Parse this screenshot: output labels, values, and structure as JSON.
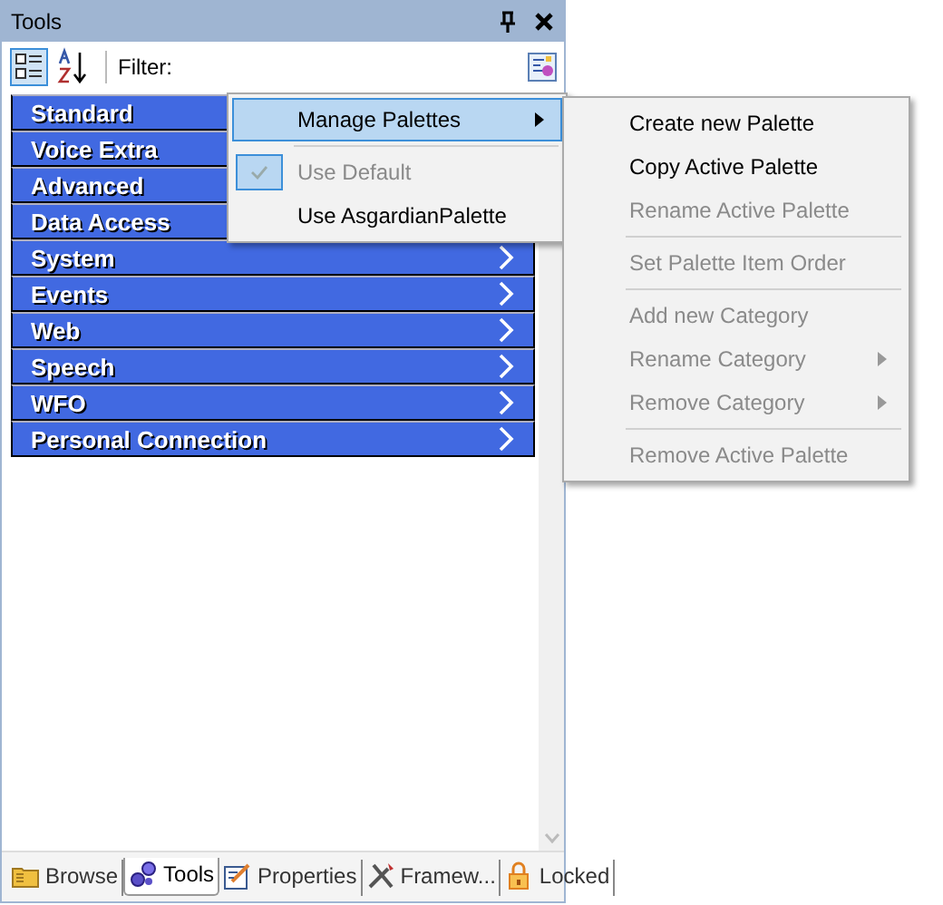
{
  "panel": {
    "title": "Tools",
    "filter_label": "Filter:"
  },
  "categories": [
    {
      "label": "Standard",
      "chevron": false
    },
    {
      "label": "Voice Extra",
      "chevron": false
    },
    {
      "label": "Advanced",
      "chevron": false
    },
    {
      "label": "Data Access",
      "chevron": false
    },
    {
      "label": "System",
      "chevron": true
    },
    {
      "label": "Events",
      "chevron": true
    },
    {
      "label": "Web",
      "chevron": true
    },
    {
      "label": "Speech",
      "chevron": true
    },
    {
      "label": "WFO",
      "chevron": true
    },
    {
      "label": "Personal Connection",
      "chevron": true
    }
  ],
  "context_menu": [
    {
      "kind": "item",
      "label": "Manage Palettes",
      "selected": true,
      "submenu": true,
      "disabled": false,
      "checked": false
    },
    {
      "kind": "separator"
    },
    {
      "kind": "item",
      "label": "Use Default",
      "selected": false,
      "submenu": false,
      "disabled": true,
      "checked": true
    },
    {
      "kind": "item",
      "label": "Use AsgardianPalette",
      "selected": false,
      "submenu": false,
      "disabled": false,
      "checked": false
    }
  ],
  "submenu": [
    {
      "kind": "item",
      "label": "Create new Palette",
      "disabled": false,
      "submenu": false
    },
    {
      "kind": "item",
      "label": "Copy Active Palette",
      "disabled": false,
      "submenu": false
    },
    {
      "kind": "item",
      "label": "Rename Active Palette",
      "disabled": true,
      "submenu": false
    },
    {
      "kind": "separator"
    },
    {
      "kind": "item",
      "label": "Set Palette Item Order",
      "disabled": true,
      "submenu": false
    },
    {
      "kind": "separator"
    },
    {
      "kind": "item",
      "label": "Add new Category",
      "disabled": true,
      "submenu": false
    },
    {
      "kind": "item",
      "label": "Rename Category",
      "disabled": true,
      "submenu": true
    },
    {
      "kind": "item",
      "label": "Remove Category",
      "disabled": true,
      "submenu": true
    },
    {
      "kind": "separator"
    },
    {
      "kind": "item",
      "label": "Remove Active Palette",
      "disabled": true,
      "submenu": false
    }
  ],
  "tabs": [
    {
      "label": "Browse",
      "selected": false
    },
    {
      "label": "Tools",
      "selected": true
    },
    {
      "label": "Properties",
      "selected": false
    },
    {
      "label": "Framew...",
      "selected": false
    },
    {
      "label": "Locked",
      "selected": false
    }
  ]
}
